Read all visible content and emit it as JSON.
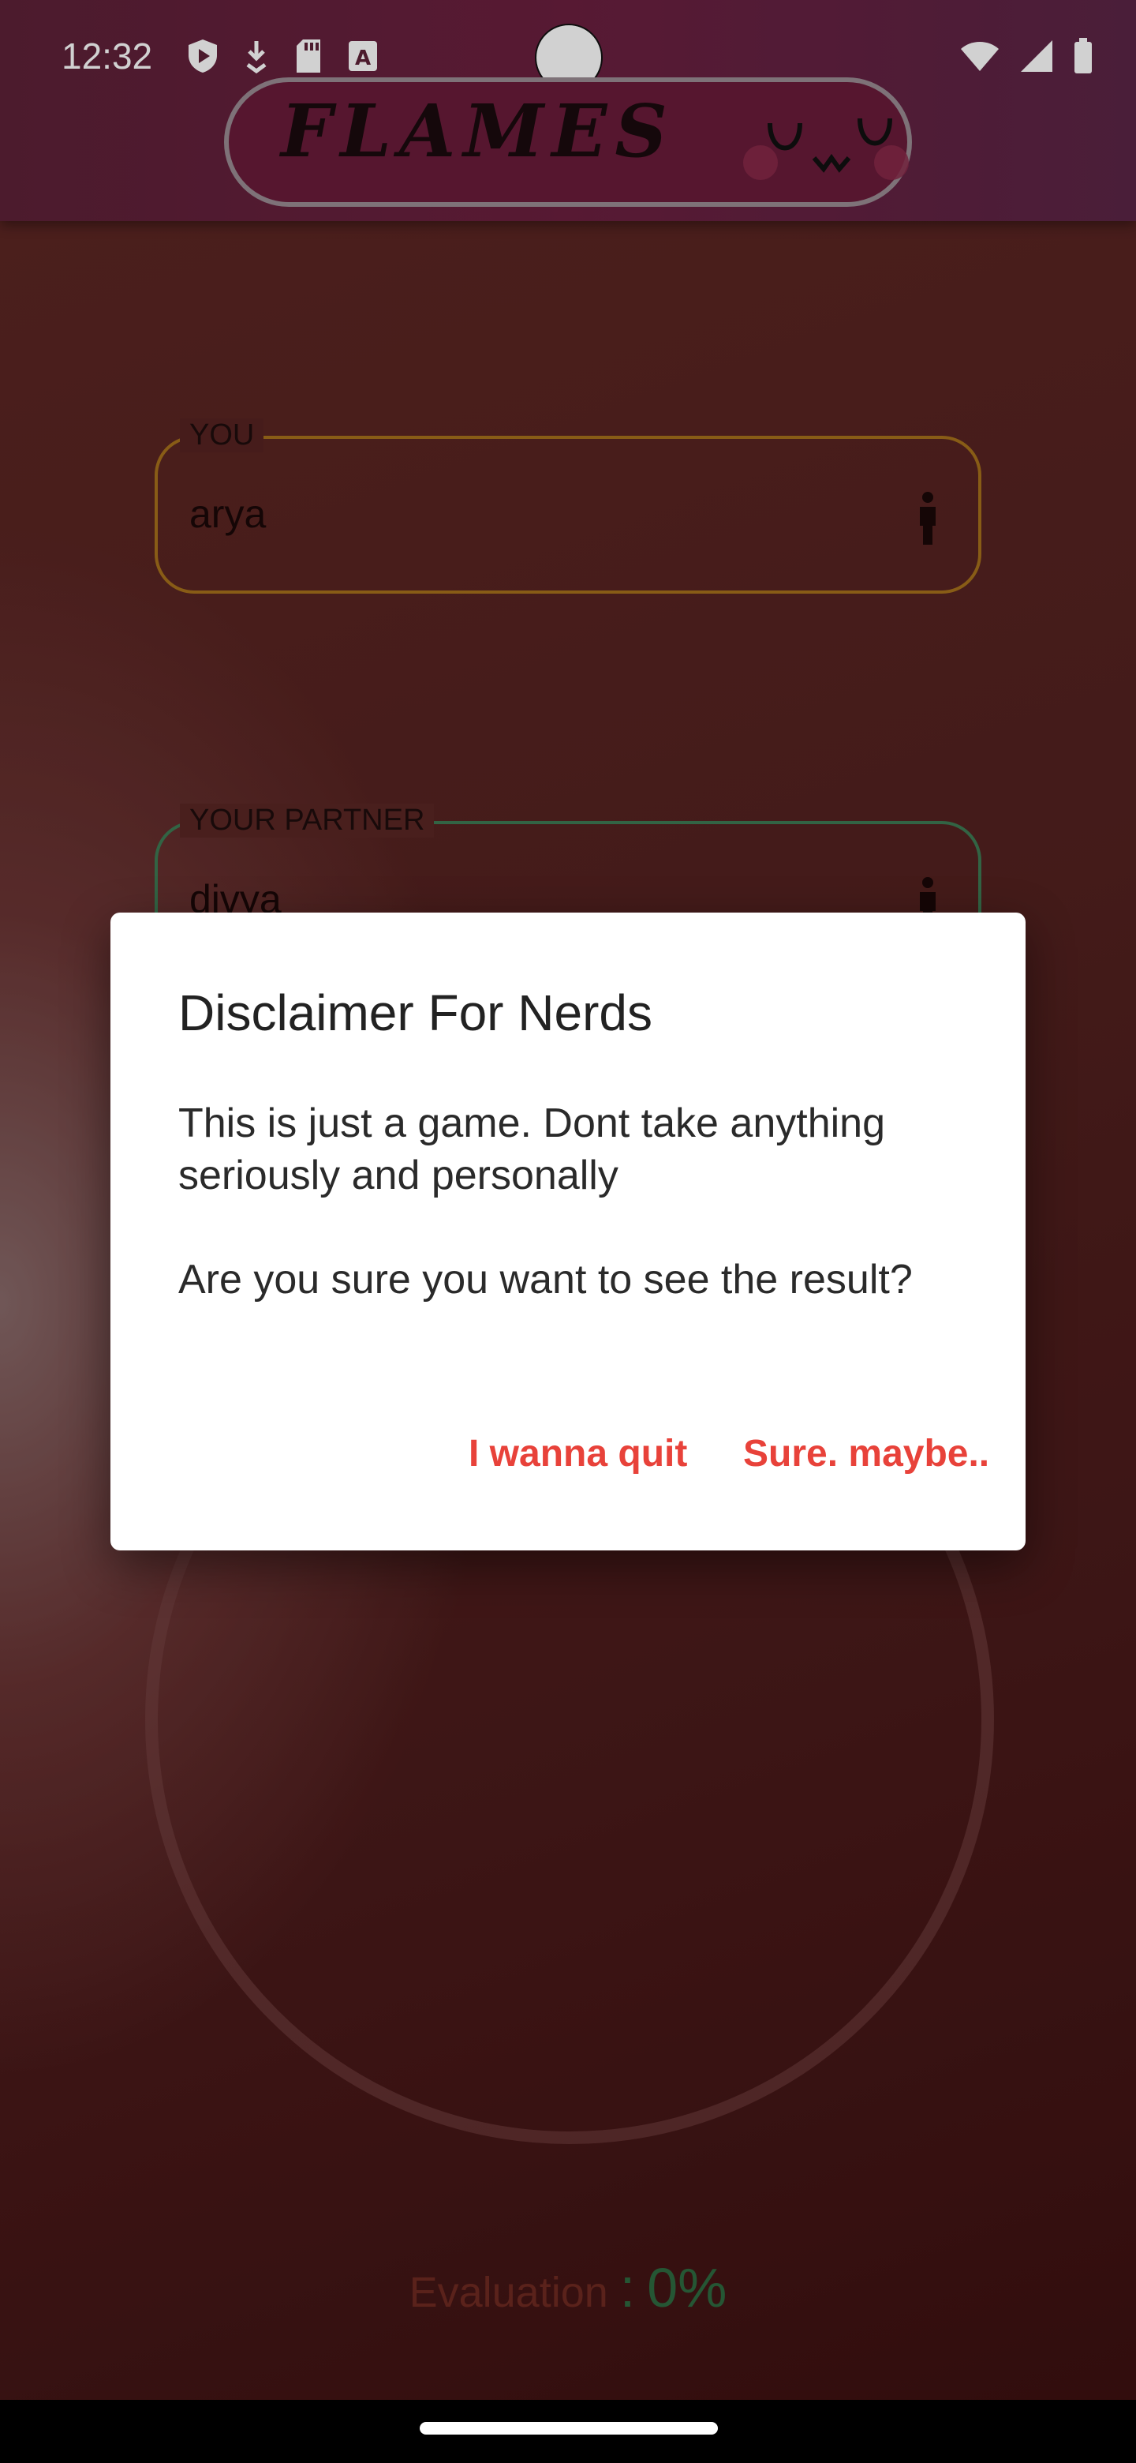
{
  "status_bar": {
    "time": "12:32",
    "icons_left": [
      "shield-play-icon",
      "download-icon",
      "sd-card-icon",
      "text-a-icon"
    ],
    "icons_right": [
      "wifi-icon",
      "signal-icon",
      "battery-icon"
    ]
  },
  "app_bar": {
    "title": "FLAMES",
    "emoji": "uwu-face"
  },
  "form": {
    "you": {
      "label": "YOU",
      "value": "arya",
      "icon": "person-icon"
    },
    "partner": {
      "label": "YOUR PARTNER",
      "value": "divya",
      "icon": "person-icon"
    }
  },
  "evaluation": {
    "label": "Evaluation",
    "colon": ":",
    "value": "0%"
  },
  "dialog": {
    "title": "Disclaimer For Nerds",
    "body": "This is just a game. Dont take anything seriously and personally\n\nAre you sure you want to see the result?",
    "quit_label": "I wanna quit",
    "confirm_label": "Sure. maybe.."
  },
  "colors": {
    "accent": "#e8423a",
    "app_bar": "#6b1f3f",
    "you_border": "#a6711c",
    "partner_border": "#3e7a54"
  }
}
